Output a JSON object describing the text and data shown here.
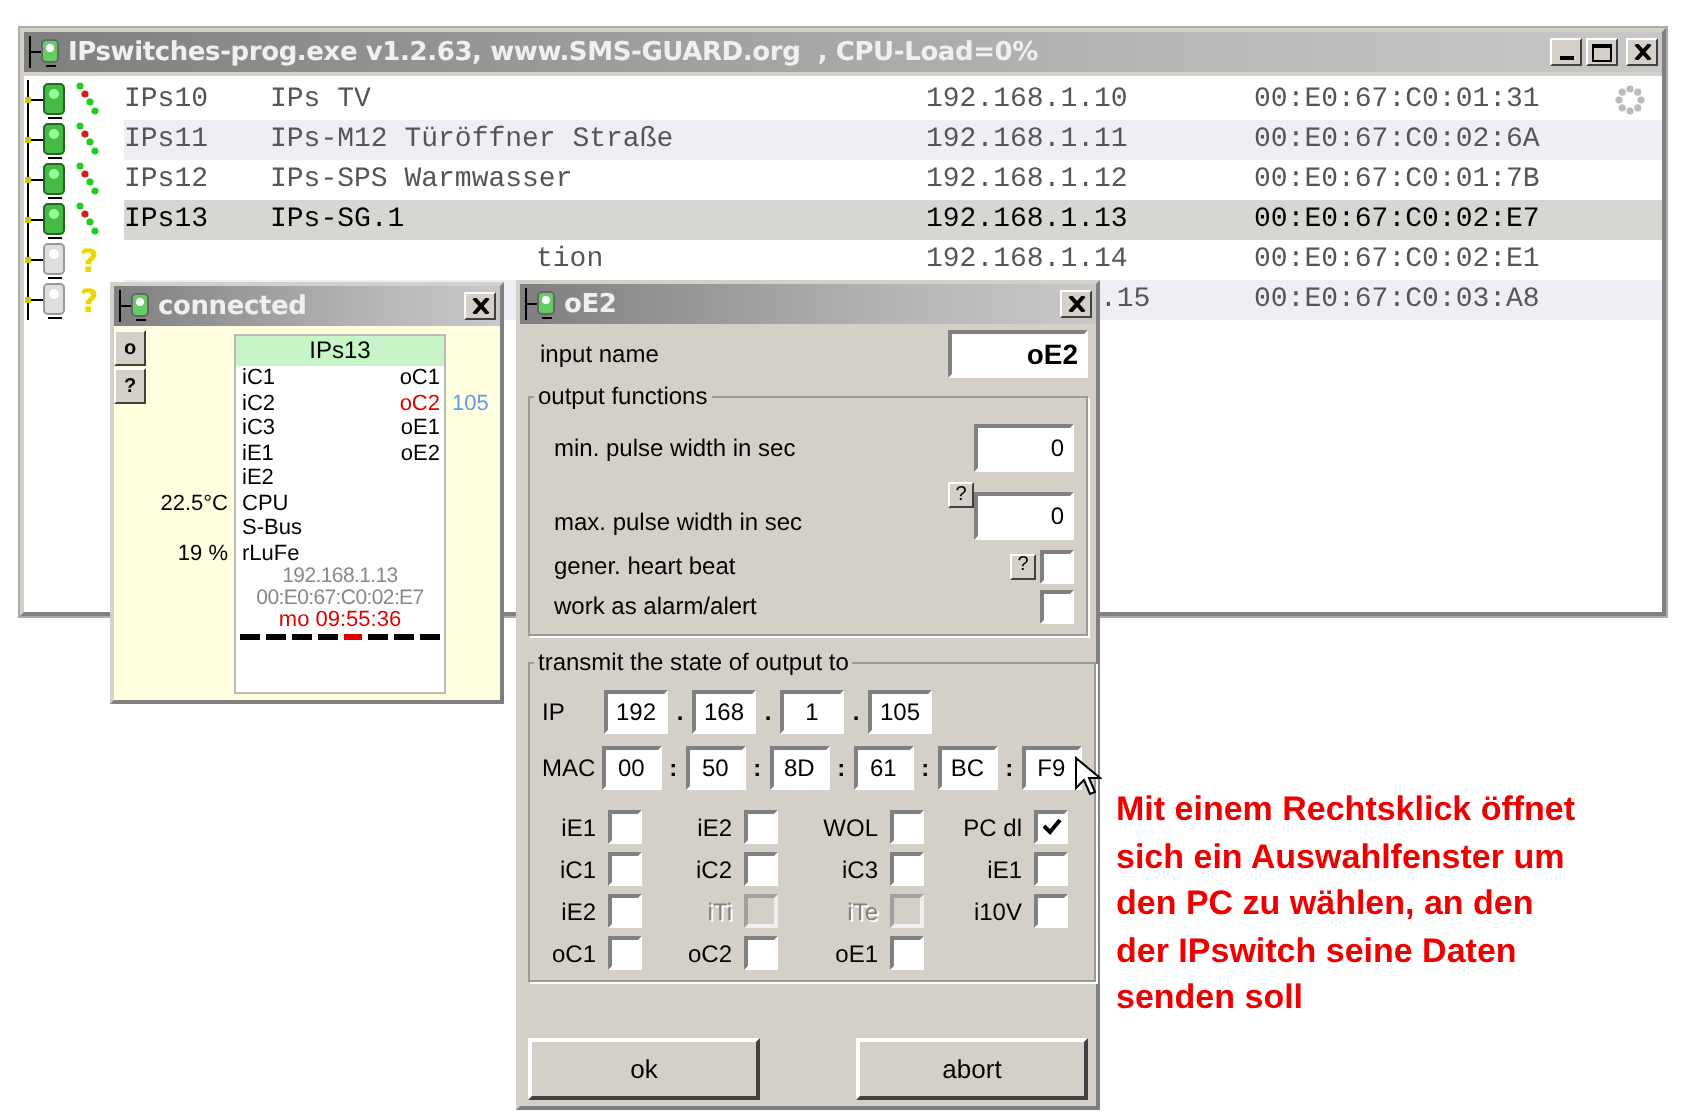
{
  "main_window": {
    "title": "IPswitches-prog.exe v1.2.63, www.SMS-GUARD.org  , CPU-Load=0%",
    "rows": [
      {
        "kind": "online",
        "id": "IPs10",
        "name": "IPs TV",
        "ip": "192.168.1.10",
        "mac": "00:E0:67:C0:01:31",
        "selected": false,
        "busy": true
      },
      {
        "kind": "online",
        "id": "IPs11",
        "name": "IPs-M12 Türöffner Straße",
        "ip": "192.168.1.11",
        "mac": "00:E0:67:C0:02:6A",
        "selected": false,
        "busy": false
      },
      {
        "kind": "online",
        "id": "IPs12",
        "name": "IPs-SPS Warmwasser",
        "ip": "192.168.1.12",
        "mac": "00:E0:67:C0:01:7B",
        "selected": false,
        "busy": false
      },
      {
        "kind": "online",
        "id": "IPs13",
        "name": "IPs-SG.1",
        "ip": "192.168.1.13",
        "mac": "00:E0:67:C0:02:E7",
        "selected": true,
        "busy": false
      },
      {
        "kind": "unknown",
        "status_mark": "?",
        "name": "tion",
        "ip": "192.168.1.14",
        "mac": "00:E0:67:C0:02:E1",
        "selected": false,
        "busy": false
      },
      {
        "kind": "unknown",
        "status_mark": "?",
        "ip": ".15",
        "mac": "00:E0:67:C0:03:A8",
        "selected": false,
        "busy": false
      }
    ]
  },
  "connected_window": {
    "title": "connected",
    "side_buttons": [
      "o",
      "?"
    ],
    "card": {
      "title": "IPs13",
      "lines": [
        {
          "left": "iC1",
          "right": "oC1"
        },
        {
          "left": "iC2",
          "right": "oC2",
          "right_alert": true,
          "suffix": "105"
        },
        {
          "left": "iC3",
          "right": "oE1"
        },
        {
          "left": "iE1",
          "right": "oE2"
        },
        {
          "left": "iE2"
        },
        {
          "prefix": "22.5°C",
          "left": "CPU"
        },
        {
          "left": "S-Bus"
        },
        {
          "prefix": "19 %",
          "left": "rLuFe"
        }
      ],
      "ip": "192.168.1.13",
      "mac": "00:E0:67:C0:02:E7",
      "time": "mo 09:55:36",
      "activity": [
        {
          "on": false
        },
        {
          "on": false
        },
        {
          "on": false
        },
        {
          "on": false
        },
        {
          "on": true
        },
        {
          "on": false
        },
        {
          "on": false
        },
        {
          "on": false
        }
      ]
    }
  },
  "output_window": {
    "title": "oE2",
    "input_name_label": "input name",
    "input_name": "oE2",
    "output_functions": {
      "legend": "output functions",
      "min_label": "min. pulse width  in sec",
      "min_value": "0",
      "help": "?",
      "max_label": "max. pulse width  in sec",
      "max_value": "0",
      "heartbeat_label": "gener. heart beat",
      "heartbeat_help": "?",
      "heartbeat": false,
      "alarm_label": "work as alarm/alert",
      "alarm": false
    },
    "transmit": {
      "legend": "transmit the state of output  to",
      "ip_label": "IP",
      "ip": [
        "192",
        "168",
        "1",
        "105"
      ],
      "ip_sep": ".",
      "mac_label": "MAC",
      "mac": [
        "00",
        "50",
        "8D",
        "61",
        "BC",
        "F9"
      ],
      "mac_sep": ":",
      "options": [
        [
          {
            "label": "iE1",
            "checked": false,
            "disabled": false
          },
          {
            "label": "iE2",
            "checked": false,
            "disabled": false
          },
          {
            "label": "WOL",
            "checked": false,
            "disabled": false
          },
          {
            "label": "PC dl",
            "checked": true,
            "disabled": false
          }
        ],
        [
          {
            "label": "iC1",
            "checked": false,
            "disabled": false
          },
          {
            "label": "iC2",
            "checked": false,
            "disabled": false
          },
          {
            "label": "iC3",
            "checked": false,
            "disabled": false
          },
          {
            "label": "iE1",
            "checked": false,
            "disabled": false
          }
        ],
        [
          {
            "label": "iE2",
            "checked": false,
            "disabled": false
          },
          {
            "label": "iTi",
            "checked": false,
            "disabled": true
          },
          {
            "label": "iTe",
            "checked": false,
            "disabled": true
          },
          {
            "label": "i10V",
            "checked": false,
            "disabled": false
          }
        ],
        [
          {
            "label": "oC1",
            "checked": false,
            "disabled": false
          },
          {
            "label": "oC2",
            "checked": false,
            "disabled": false
          },
          {
            "label": "oE1",
            "checked": false,
            "disabled": false
          }
        ]
      ]
    },
    "buttons": [
      "ok",
      "abort"
    ]
  },
  "annotation": "Mit einem Rechtsklick öffnet\nsich ein Auswahlfenster um\nden PC zu wählen, an den\nder IPswitch seine Daten\nsenden soll"
}
